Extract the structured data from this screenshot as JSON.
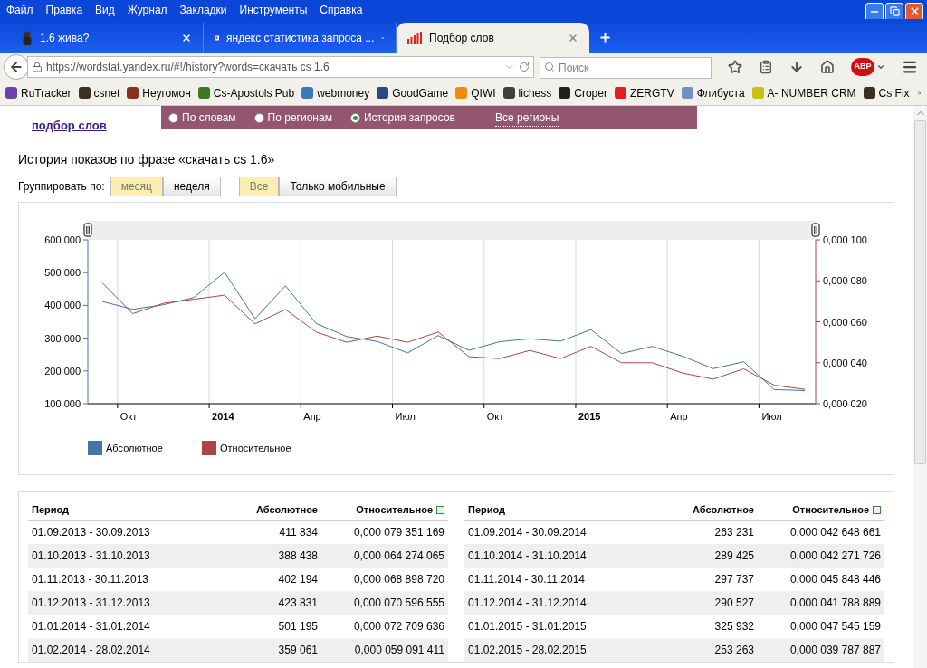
{
  "menu": [
    "Файл",
    "Правка",
    "Вид",
    "Журнал",
    "Закладки",
    "Инструменты",
    "Справка"
  ],
  "tabs": [
    {
      "title": "1.6 жива?",
      "kind": "figure",
      "selected": false
    },
    {
      "title": "яндекс статистика запроса ...",
      "kind": "yandex",
      "selected": false
    },
    {
      "title": "Подбор слов",
      "kind": "bars",
      "selected": true
    }
  ],
  "address": {
    "value": "https://wordstat.yandex.ru/#!/history?words=скачать cs 1.6"
  },
  "search": {
    "placeholder": "Поиск"
  },
  "abp_label": "ABP",
  "bookmarks": [
    {
      "label": "RuTracker",
      "color": "#6a3fb0"
    },
    {
      "label": "csnet",
      "color": "#3a3020"
    },
    {
      "label": "Неугомон",
      "color": "#8a3020"
    },
    {
      "label": "Cs-Apostols Pub",
      "color": "#3a7a20"
    },
    {
      "label": "webmoney",
      "color": "#3a78b8"
    },
    {
      "label": "GoodGame",
      "color": "#2a4a80"
    },
    {
      "label": "QIWI",
      "color": "#f08a10"
    },
    {
      "label": "lichess",
      "color": "#404040"
    },
    {
      "label": "Croper",
      "color": "#202020"
    },
    {
      "label": "ZERGTV",
      "color": "#e02020"
    },
    {
      "label": "Флибуста",
      "color": "#7090c0"
    },
    {
      "label": "A- NUMBER CRM",
      "color": "#c8c010"
    },
    {
      "label": "Cs Fix",
      "color": "#3a3020"
    }
  ],
  "site_link": "подбор слов",
  "modes": [
    {
      "label": "По словам",
      "selected": false
    },
    {
      "label": "По регионам",
      "selected": false
    },
    {
      "label": "История запросов",
      "selected": true
    }
  ],
  "regions_link": "Все регионы",
  "heading": "История показов по фразе «скачать cs 1.6»",
  "group_label": "Группировать по:",
  "group_buttons": [
    {
      "label": "месяц",
      "selected": true
    },
    {
      "label": "неделя",
      "selected": false
    }
  ],
  "device_buttons": [
    {
      "label": "Все",
      "selected": true
    },
    {
      "label": "Только мобильные",
      "selected": false
    }
  ],
  "chart_data": {
    "type": "line",
    "categories": [
      null,
      "Окт",
      null,
      null,
      "2014",
      null,
      null,
      "Апр",
      null,
      null,
      "Июл",
      null,
      null,
      "Окт",
      null,
      null,
      "2015",
      null,
      null,
      "Апр",
      null,
      null,
      "Июл",
      null
    ],
    "ylim": [
      100000,
      600000
    ],
    "yticks": [
      {
        "value": 100000,
        "label": "100 000"
      },
      {
        "value": 200000,
        "label": "200 000"
      },
      {
        "value": 300000,
        "label": "300 000"
      },
      {
        "value": 400000,
        "label": "400 000"
      },
      {
        "value": 500000,
        "label": "500 000"
      },
      {
        "value": 600000,
        "label": "600 000"
      }
    ],
    "y2lim": [
      2e-05,
      0.0001
    ],
    "legend": "bottom",
    "y2ticks": [
      {
        "value": 2e-05,
        "label": "0,000 020"
      },
      {
        "value": 4e-05,
        "label": "0,000 040"
      },
      {
        "value": 6e-05,
        "label": "0,000 060"
      },
      {
        "value": 8e-05,
        "label": "0,000 080"
      },
      {
        "value": 0.0001,
        "label": "0,000 100"
      }
    ],
    "series": [
      {
        "name": "Абсолютное",
        "color": "#4572a7",
        "values": [
          412000,
          388000,
          402000,
          424000,
          501000,
          359000,
          460000,
          345000,
          305000,
          290000,
          255000,
          308000,
          263000,
          289000,
          298000,
          291000,
          326000,
          253000,
          275000,
          245000,
          207000,
          228000,
          143000,
          140000
        ]
      },
      {
        "name": "Относительное",
        "color": "#aa4643",
        "axis": "y2",
        "values": [
          7.9e-05,
          6.4e-05,
          6.9e-05,
          7.1e-05,
          7.3e-05,
          5.9e-05,
          6.6e-05,
          5.5e-05,
          5e-05,
          5.3e-05,
          5e-05,
          5.5e-05,
          4.3e-05,
          4.2e-05,
          4.6e-05,
          4.2e-05,
          4.8e-05,
          4e-05,
          4e-05,
          3.5e-05,
          3.2e-05,
          3.7e-05,
          2.9e-05,
          2.7e-05
        ]
      }
    ]
  },
  "tables": [
    {
      "columns": [
        "Период",
        "Абсолютное",
        "Относительное"
      ],
      "rows": [
        [
          "01.09.2013 - 30.09.2013",
          "411 834",
          "0,000 079 351 169"
        ],
        [
          "01.10.2013 - 31.10.2013",
          "388 438",
          "0,000 064 274 065"
        ],
        [
          "01.11.2013 - 30.11.2013",
          "402 194",
          "0,000 068 898 720"
        ],
        [
          "01.12.2013 - 31.12.2013",
          "423 831",
          "0,000 070 596 555"
        ],
        [
          "01.01.2014 - 31.01.2014",
          "501 195",
          "0,000 072 709 636"
        ],
        [
          "01.02.2014 - 28.02.2014",
          "359 061",
          "0,000 059 091 411"
        ]
      ]
    },
    {
      "columns": [
        "Период",
        "Абсолютное",
        "Относительное"
      ],
      "rows": [
        [
          "01.09.2014 - 30.09.2014",
          "263 231",
          "0,000 042 648 661"
        ],
        [
          "01.10.2014 - 31.10.2014",
          "289 425",
          "0,000 042 271 726"
        ],
        [
          "01.11.2014 - 30.11.2014",
          "297 737",
          "0,000 045 848 446"
        ],
        [
          "01.12.2014 - 31.12.2014",
          "290 527",
          "0,000 041 788 889"
        ],
        [
          "01.01.2015 - 31.01.2015",
          "325 932",
          "0,000 047 545 159"
        ],
        [
          "01.02.2015 - 28.02.2015",
          "253 263",
          "0,000 039 787 887"
        ]
      ]
    }
  ]
}
